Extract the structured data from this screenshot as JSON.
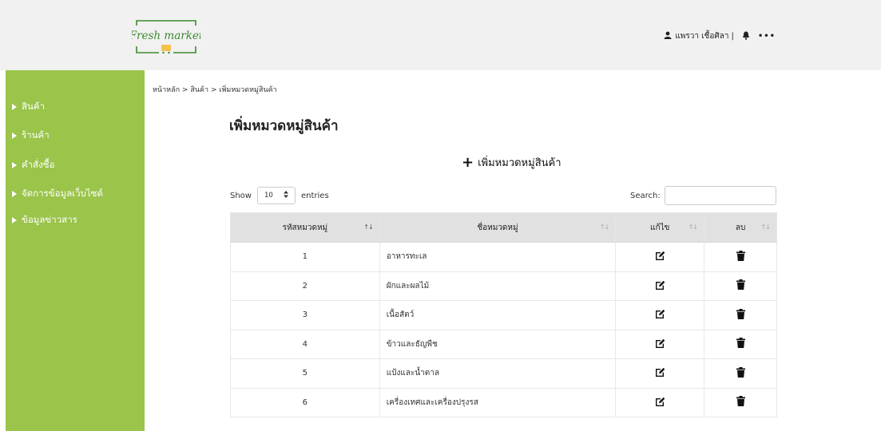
{
  "header": {
    "logo_text": "Fresh market",
    "user_name": "แพรวา เชื้อศิลา",
    "separator": "|",
    "more": "•••"
  },
  "sidebar": {
    "items": [
      {
        "label": "สินค้า"
      },
      {
        "label": "ร้านค้า"
      },
      {
        "label": "คำสั่งซื้อ"
      },
      {
        "label": "จัดการข้อมูลเว็บไซต์"
      },
      {
        "label": "ข้อมูลข่าวสาร"
      }
    ]
  },
  "breadcrumb": {
    "home": "หน้าหลัก",
    "sep": ">",
    "products": "สินค้า",
    "current": "เพิ่มหมวดหมู่สินค้า"
  },
  "page_title": "เพิ่มหมวดหมู่สินค้า",
  "add_button": {
    "plus": "+",
    "label": "เพิ่มหมวดหมู่สินค้า"
  },
  "entries": {
    "show": "Show",
    "value": "10",
    "suffix": "entries"
  },
  "search": {
    "label": "Search:",
    "value": ""
  },
  "table": {
    "headers": [
      "รหัสหมวดหมู่",
      "ชื่อหมวดหมู่",
      "แก้ไข",
      "ลบ"
    ],
    "sort_glyph": "↑↓",
    "rows": [
      {
        "id": "1",
        "name": "อาหารทะเล"
      },
      {
        "id": "2",
        "name": "ผักและผลไม้"
      },
      {
        "id": "3",
        "name": "เนื้อสัตว์"
      },
      {
        "id": "4",
        "name": "ข้าวและธัญพืช"
      },
      {
        "id": "5",
        "name": "แป้งและน้ำตาล"
      },
      {
        "id": "6",
        "name": "เครื่องเทศและเครื่องปรุงรส"
      }
    ]
  },
  "icons": {
    "user": "user-icon",
    "bell": "bell-icon",
    "edit": "edit-icon",
    "delete": "trash-icon",
    "cart": "cart-icon"
  },
  "colors": {
    "sidebar": "#9ac44a",
    "logo_green": "#3c8a2e",
    "logo_yellow": "#f2c14e",
    "header_bg": "#f1f1f1",
    "table_header_bg": "#e1e1e1"
  }
}
